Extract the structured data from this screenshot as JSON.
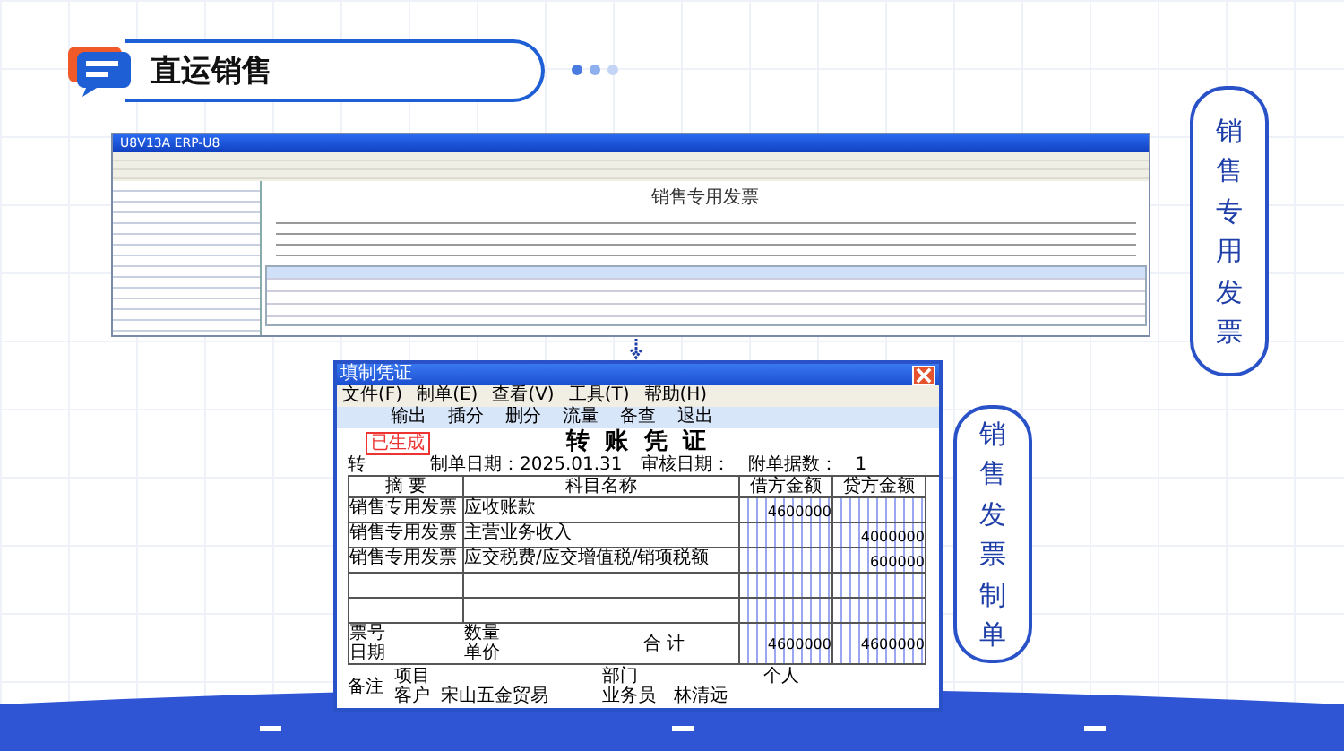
{
  "header": {
    "title": "直运销售"
  },
  "invoice_screenshot": {
    "window_title": "U8V13A ERP-U8",
    "form_title": "销售专用发票"
  },
  "callouts": [
    {
      "text": "销售专用发票"
    },
    {
      "text": "销售发票制单"
    }
  ],
  "voucher_window": {
    "title": "填制凭证",
    "menu": [
      "文件(F)",
      "制单(E)",
      "查看(V)",
      "工具(T)",
      "帮助(H)"
    ],
    "toolbar": [
      "输出",
      "插分",
      "删分",
      "流量",
      "备查",
      "退出"
    ],
    "stamp": "已生成",
    "voucher_title": "转 账 凭 证",
    "prefix": "转",
    "date_label": "制单日期：2025.01.31",
    "audit_label": "审核日期：",
    "attach_label": "附单据数：",
    "attach_count": "1",
    "columns": [
      "摘 要",
      "科目名称",
      "借方金额",
      "贷方金额"
    ],
    "rows": [
      {
        "summary": "销售专用发票",
        "account": "应收账款",
        "debit": "4600000"
      },
      {
        "summary": "销售专用发票",
        "account": "主营业务收入",
        "credit": "4000000"
      },
      {
        "summary": "销售专用发票",
        "account": "应交税费/应交增值税/销项税额",
        "credit": "600000"
      },
      {},
      {}
    ],
    "footer": {
      "ticket": "票号",
      "date": "日期",
      "qty": "数量",
      "price": "单价",
      "total_label": "合 计",
      "debit_total": "4600000",
      "credit_total": "4600000",
      "note": "备注",
      "project": "项目",
      "dept": "部门",
      "person": "个人",
      "customer_label": "客户",
      "customer": "宋山五金贸易",
      "salesman_label": "业务员",
      "salesman": "林清远"
    }
  }
}
